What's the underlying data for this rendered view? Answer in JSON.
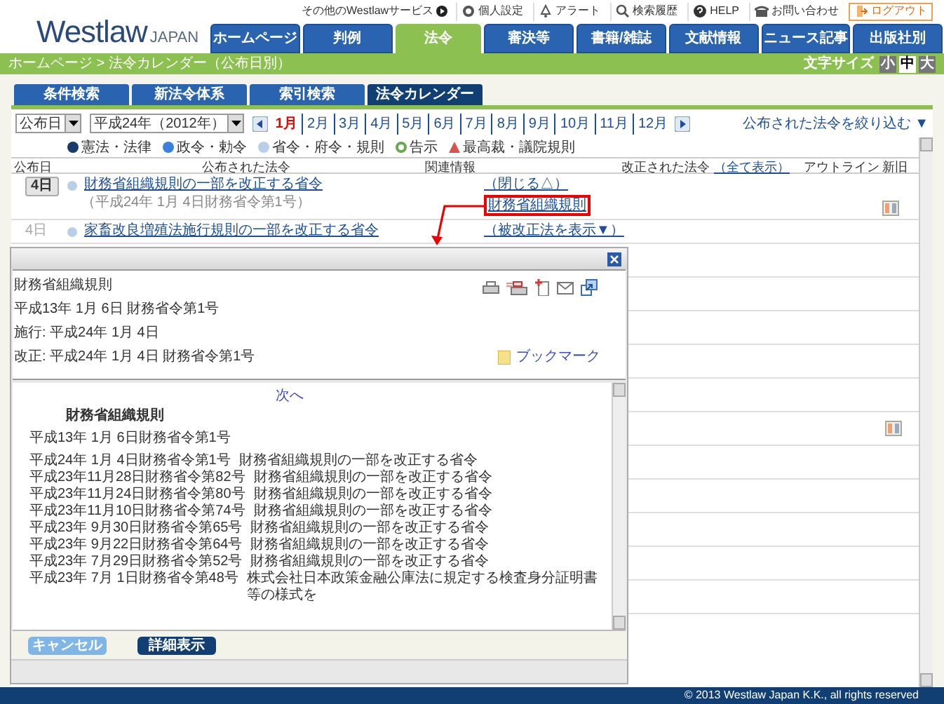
{
  "header": {
    "logo": "Westlaw",
    "logo_sub": "JAPAN",
    "top_links": [
      {
        "label": "その他のWestlawサービス",
        "kind": "service"
      },
      {
        "label": "個人設定",
        "kind": "settings"
      },
      {
        "label": "アラート",
        "kind": "alert"
      },
      {
        "label": "検索履歴",
        "kind": "history"
      },
      {
        "label": "HELP",
        "kind": "help"
      },
      {
        "label": "お問い合わせ",
        "kind": "contact"
      },
      {
        "label": "ログアウト",
        "kind": "logout"
      }
    ],
    "nav_tabs": [
      {
        "label": "ホームページ",
        "selected": false
      },
      {
        "label": "判例",
        "selected": false
      },
      {
        "label": "法令",
        "selected": true
      },
      {
        "label": "審決等",
        "selected": false
      },
      {
        "label": "書籍/雑誌",
        "selected": false
      },
      {
        "label": "文献情報",
        "selected": false
      },
      {
        "label": "ニュース記事",
        "selected": false
      },
      {
        "label": "出版社別",
        "selected": false
      }
    ]
  },
  "breadcrumb": "ホームページ > 法令カレンダー（公布日別）",
  "font_size": {
    "label": "文字サイズ",
    "options": [
      {
        "label": "小",
        "selected": false
      },
      {
        "label": "中",
        "selected": true
      },
      {
        "label": "大",
        "selected": false
      }
    ]
  },
  "sub_tabs": [
    {
      "label": "条件検索",
      "selected": false
    },
    {
      "label": "新法令体系",
      "selected": false
    },
    {
      "label": "索引検索",
      "selected": false
    },
    {
      "label": "法令カレンダー",
      "selected": true
    }
  ],
  "filters": {
    "date_type": "公布日",
    "year": "平成24年（2012年）",
    "months": [
      {
        "label": "1月",
        "selected": true
      },
      {
        "label": "2月",
        "selected": false
      },
      {
        "label": "3月",
        "selected": false
      },
      {
        "label": "4月",
        "selected": false
      },
      {
        "label": "5月",
        "selected": false
      },
      {
        "label": "6月",
        "selected": false
      },
      {
        "label": "7月",
        "selected": false
      },
      {
        "label": "8月",
        "selected": false
      },
      {
        "label": "9月",
        "selected": false
      },
      {
        "label": "10月",
        "selected": false
      },
      {
        "label": "11月",
        "selected": false
      },
      {
        "label": "12月",
        "selected": false
      }
    ],
    "narrow_link": "公布された法令を絞り込む ▼"
  },
  "legend": [
    {
      "label": "憲法・法律",
      "kind": "dot",
      "color": "#1a3a6b"
    },
    {
      "label": "政令・勅令",
      "kind": "dot",
      "color": "#3d7fe0"
    },
    {
      "label": "省令・府令・規則",
      "kind": "dot",
      "color": "#b9cfe8"
    },
    {
      "label": "告示",
      "kind": "ring",
      "color": "#6aa84f"
    },
    {
      "label": "最高裁・議院規則",
      "kind": "triangle",
      "color": "#d9534f"
    }
  ],
  "columns": [
    {
      "label": "公布日"
    },
    {
      "label": "公布された法令"
    },
    {
      "label": "関連情報"
    },
    {
      "label": "改正された法令",
      "link": "（全て表示）"
    },
    {
      "label": "アウトライン"
    },
    {
      "label": "新旧"
    }
  ],
  "rows": [
    {
      "date": "4日",
      "date_button": true,
      "color": "#b9cfe8",
      "title": "財務省組織規則の一部を改正する省令",
      "subtitle": "（平成24年 1月 4日財務省令第1号）",
      "related_toggle": "（閉じる△）",
      "related_law": "財務省組織規則",
      "highlighted": true,
      "comparison_icon": true
    },
    {
      "date": "4日",
      "date_button": false,
      "color": "#b9cfe8",
      "title": "家畜改良増殖法施行規則の一部を改正する省令",
      "related_toggle": "（被改正法を表示▼）",
      "comparison_icon": false
    }
  ],
  "covered_rows": [
    {
      "comparison_icon": false
    },
    {
      "comparison_icon": false
    },
    {
      "comparison_icon": false
    },
    {
      "comparison_icon": false
    },
    {
      "comparison_icon": false
    },
    {
      "comparison_icon": true
    },
    {
      "comparison_icon": false
    },
    {
      "comparison_icon": false
    },
    {
      "comparison_icon": false
    },
    {
      "comparison_icon": false
    },
    {
      "comparison_icon": false
    }
  ],
  "popup": {
    "info_lines": [
      "財務省組織規則",
      "平成13年 1月 6日 財務省令第1号",
      "施行: 平成24年 1月 4日",
      "改正: 平成24年 1月 4日 財務省令第1号"
    ],
    "bookmark": "ブックマーク",
    "next_link": "次へ",
    "doc_title": "財務省組織規則",
    "doc_number": "平成13年 1月 6日財務省令第1号",
    "amendments": [
      {
        "ref": "平成24年 1月 4日財務省令第1号",
        "title": "財務省組織規則の一部を改正する省令"
      },
      {
        "ref": "平成23年11月28日財務省令第82号",
        "title": "財務省組織規則の一部を改正する省令"
      },
      {
        "ref": "平成23年11月24日財務省令第80号",
        "title": "財務省組織規則の一部を改正する省令"
      },
      {
        "ref": "平成23年11月10日財務省令第74号",
        "title": "財務省組織規則の一部を改正する省令"
      },
      {
        "ref": "平成23年 9月30日財務省令第65号",
        "title": "財務省組織規則の一部を改正する省令"
      },
      {
        "ref": "平成23年 9月22日財務省令第64号",
        "title": "財務省組織規則の一部を改正する省令"
      },
      {
        "ref": "平成23年 7月29日財務省令第52号",
        "title": "財務省組織規則の一部を改正する省令"
      },
      {
        "ref": "平成23年 7月 1日財務省令第48号",
        "title": "株式会社日本政策金融公庫法に規定する検査身分証明書等の様式を"
      }
    ],
    "buttons": [
      {
        "label": "キャンセル",
        "kind": "secondary"
      },
      {
        "label": "詳細表示",
        "kind": "primary"
      }
    ]
  },
  "footer": "© 2013 Westlaw Japan K.K., all rights reserved"
}
